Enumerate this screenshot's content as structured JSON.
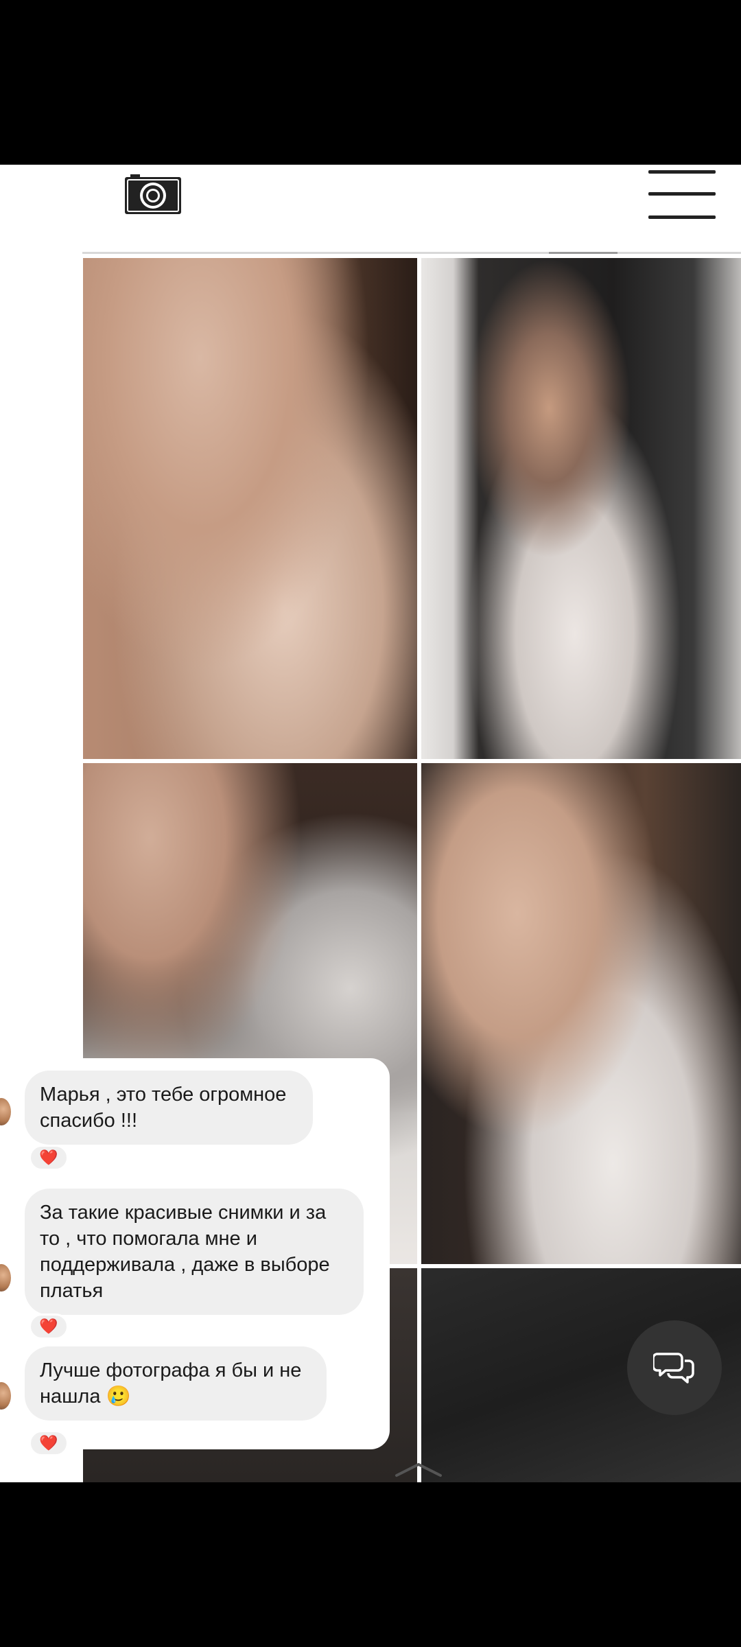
{
  "header": {
    "logo_icon": "camera-icon",
    "menu_icon": "hamburger-menu-icon"
  },
  "gallery": {
    "photos": [
      {
        "alt": "photo-1"
      },
      {
        "alt": "photo-2"
      },
      {
        "alt": "photo-3"
      },
      {
        "alt": "photo-4"
      },
      {
        "alt": "photo-5"
      },
      {
        "alt": "photo-6"
      }
    ]
  },
  "chat": {
    "messages": [
      {
        "text": "Марья , это тебе огромное спасибо !!!",
        "reaction": "❤️"
      },
      {
        "text": "За такие красивые снимки и за то , что помогала мне и поддерживала , даже в выборе платья",
        "reaction": "❤️"
      },
      {
        "text": "Лучше фотографа я бы и не нашла 🥲",
        "reaction": "❤️"
      }
    ]
  },
  "floating": {
    "chat_icon": "chat-bubbles-icon",
    "scroll_icon": "chevron-up-icon"
  },
  "colors": {
    "fab_bg": "#333333",
    "bubble_bg": "#efefef",
    "heart": "#e0245e"
  }
}
